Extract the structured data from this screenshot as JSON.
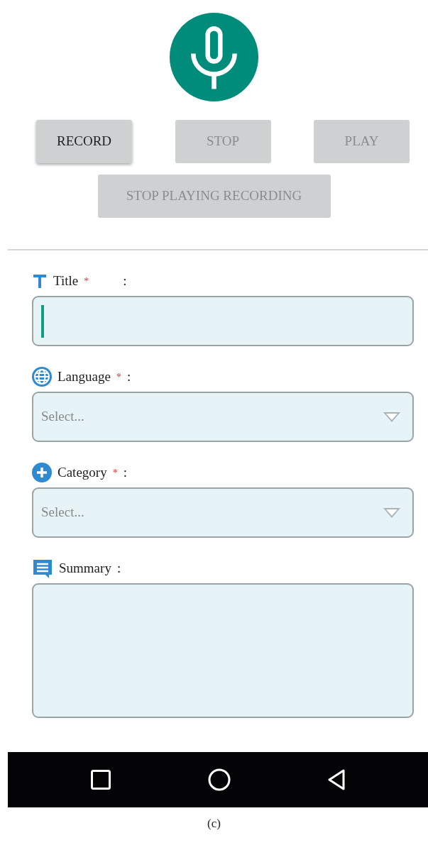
{
  "buttons": [
    {
      "label": "RECORD",
      "disabled": false
    },
    {
      "label": "STOP",
      "disabled": true
    },
    {
      "label": "PLAY",
      "disabled": true
    },
    {
      "label": "STOP PLAYING RECORDING",
      "disabled": true
    }
  ],
  "fields": [
    {
      "kind": "text",
      "label": "Title",
      "required_mark": "*",
      "colon": ":",
      "focused": true
    },
    {
      "kind": "select",
      "label": "Language",
      "required_mark": "*",
      "colon": ":",
      "placeholder": "Select..."
    },
    {
      "kind": "select",
      "label": "Category",
      "required_mark": "*",
      "colon": ":",
      "placeholder": "Select..."
    },
    {
      "kind": "textarea",
      "label": "Summary",
      "colon": ":"
    }
  ],
  "caption": "(c)"
}
